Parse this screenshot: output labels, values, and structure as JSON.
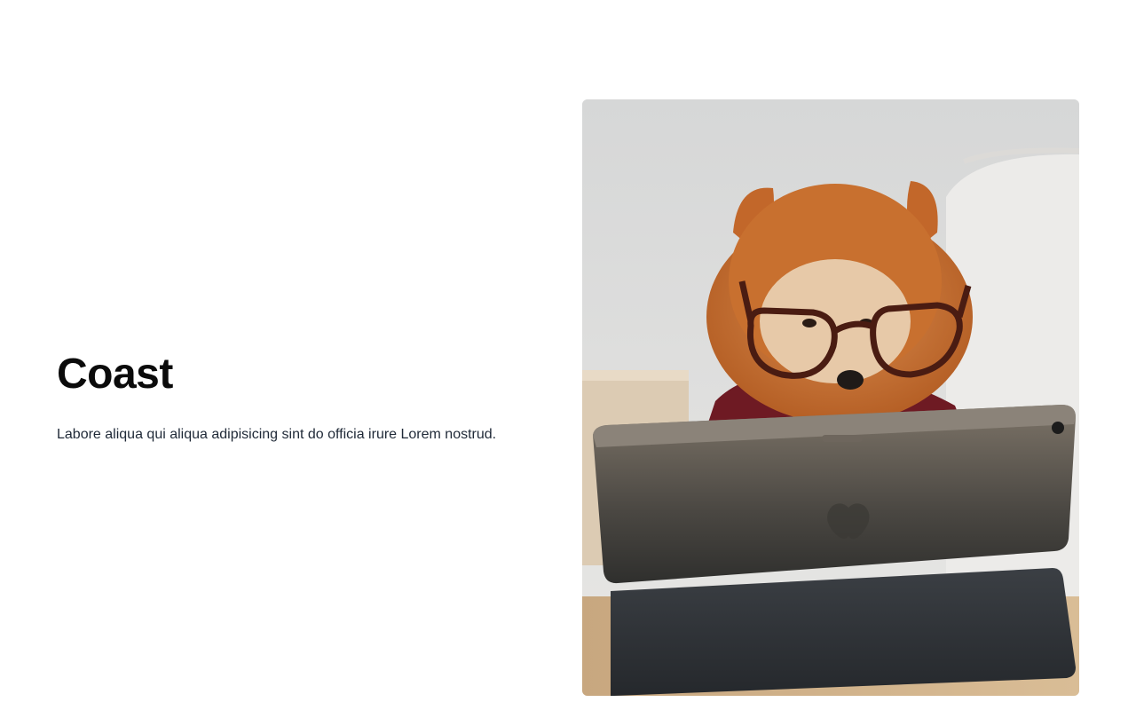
{
  "section": {
    "title": "Coast",
    "description": "Labore aliqua qui aliqua adipisicing sint do officia irure Lorem nostrud."
  },
  "image": {
    "alt": "",
    "icon": "photo-icon"
  }
}
